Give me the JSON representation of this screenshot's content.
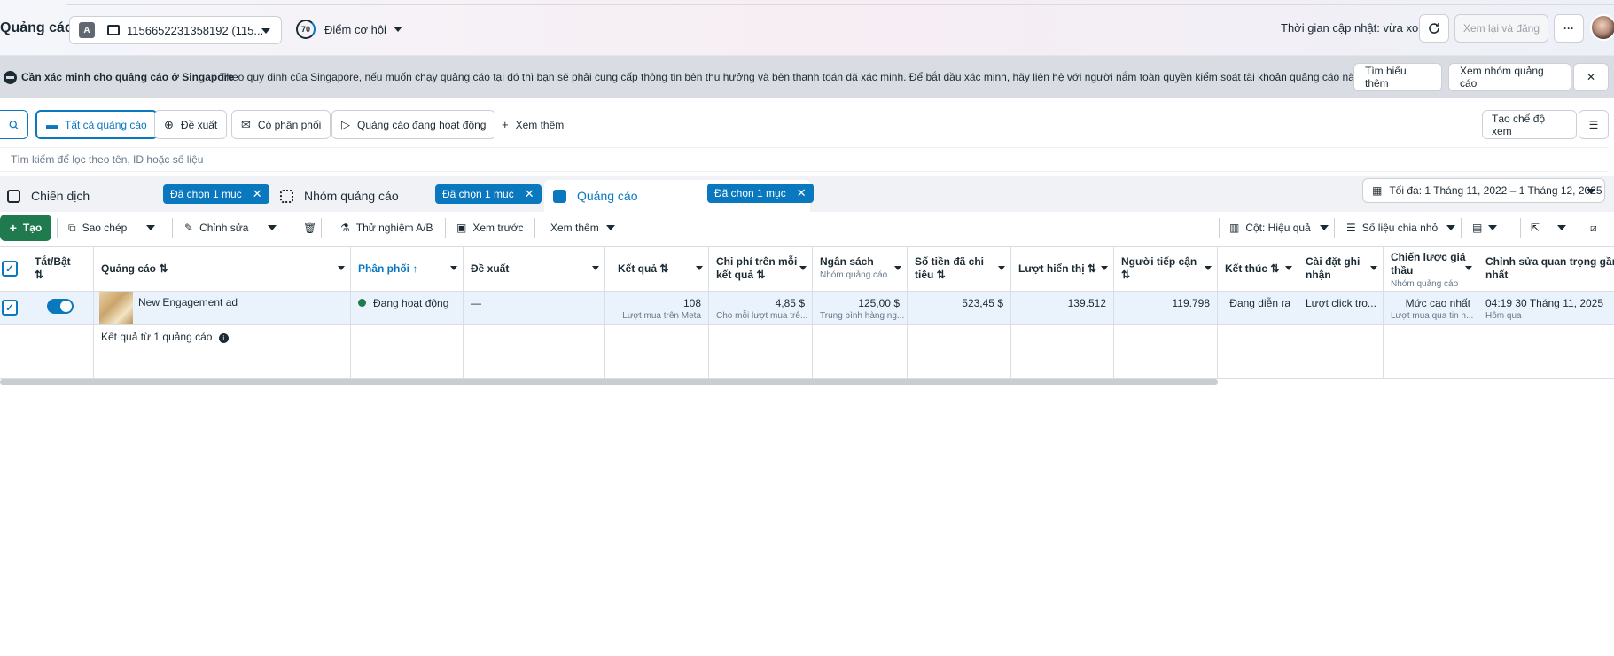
{
  "header": {
    "title": "Quảng cáo",
    "account_badge": "A",
    "account_id": "1156652231358192 (115...",
    "score_value": "70",
    "score_label": "Điểm cơ hội",
    "updated_text": "Thời gian cập nhật: vừa xong",
    "review_label": "Xem lại và đăng",
    "more_label": "···"
  },
  "banner": {
    "title": "Cần xác minh cho quảng cáo ở Singapore",
    "text": "Theo quy định của Singapore, nếu muốn chạy quảng cáo tại đó thì bạn sẽ phải cung cấp thông tin bên thụ hưởng và bên thanh toán đã xác minh. Để bắt đầu xác minh, hãy liên hệ với người nắm toàn quyền kiểm soát tài khoản quảng cáo này.",
    "learn_more": "Tìm hiểu thêm",
    "view_adsets": "Xem nhóm quảng cáo",
    "close": "✕"
  },
  "filters": {
    "all_ads": "Tất cả quảng cáo",
    "recommendations": "Đề xuất",
    "delivering": "Có phân phối",
    "active_ads": "Quảng cáo đang hoạt động",
    "see_more": "Xem thêm",
    "create_view": "Tạo chế độ xem"
  },
  "search": {
    "placeholder": "Tìm kiếm để lọc theo tên, ID hoặc số liệu"
  },
  "tabs": {
    "campaigns": "Chiến dịch",
    "campaigns_chip": "Đã chọn 1 mục",
    "adsets": "Nhóm quảng cáo",
    "adsets_chip": "Đã chọn 1 mục",
    "ads": "Quảng cáo",
    "ads_chip": "Đã chọn 1 mục",
    "chip_close": "✕"
  },
  "date_range": "Tối đa: 1 Tháng 11, 2022 – 1 Tháng 12, 2025",
  "toolbar": {
    "create": "Tạo",
    "duplicate": "Sao chép",
    "edit": "Chỉnh sửa",
    "ab_test": "Thử nghiệm A/B",
    "preview": "Xem trước",
    "see_more": "Xem thêm",
    "columns": "Cột: Hiệu quả",
    "breakdown": "Số liệu chia nhỏ"
  },
  "table": {
    "headers": {
      "toggle": "Tắt/Bật",
      "toggle_sort": "⇅",
      "ad": "Quảng cáo ⇅",
      "delivery": "Phân phối ↑",
      "recommendations": "Đề xuất",
      "results": "Kết quả ⇅",
      "cost_per_result_1": "Chi phí trên mỗi",
      "cost_per_result_2": "kết quả ⇅",
      "budget": "Ngân sách",
      "budget_sub": "Nhóm quảng cáo",
      "amount_spent_1": "Số tiền đã chi",
      "amount_spent_2": "tiêu ⇅",
      "impressions": "Lượt hiển thị ⇅",
      "reach_1": "Người tiếp cận",
      "reach_2": "⇅",
      "ends": "Kết thúc ⇅",
      "attribution_1": "Cài đặt ghi",
      "attribution_2": "nhận",
      "bid_strategy_1": "Chiến lược giá",
      "bid_strategy_2": "thầu",
      "bid_strategy_sub": "Nhóm quảng cáo",
      "last_edit_1": "Chỉnh sửa quan trọng gần đây",
      "last_edit_2": "nhất"
    },
    "row": {
      "name": "New Engagement ad",
      "delivery": "Đang hoạt động",
      "recommendations": "—",
      "results": "108",
      "results_sub": "Lượt mua trên Meta",
      "cost_per_result": "4,85 $",
      "cost_per_result_sub": "Cho mỗi lượt mua trê...",
      "budget": "125,00 $",
      "budget_sub": "Trung bình hàng ng...",
      "amount_spent": "523,45 $",
      "impressions": "139.512",
      "reach": "119.798",
      "ends": "Đang diễn ra",
      "attribution": "Lượt click tro...",
      "bid_strategy": "Mức cao nhất",
      "bid_strategy_sub": "Lượt mua qua tin n...",
      "last_edit": "04:19 30 Tháng 11, 2025",
      "last_edit_sub": "Hôm qua"
    },
    "summary": "Kết quả từ 1 quảng cáo"
  },
  "colors": {
    "primary": "#0a78be",
    "create": "#1f7a4d"
  }
}
